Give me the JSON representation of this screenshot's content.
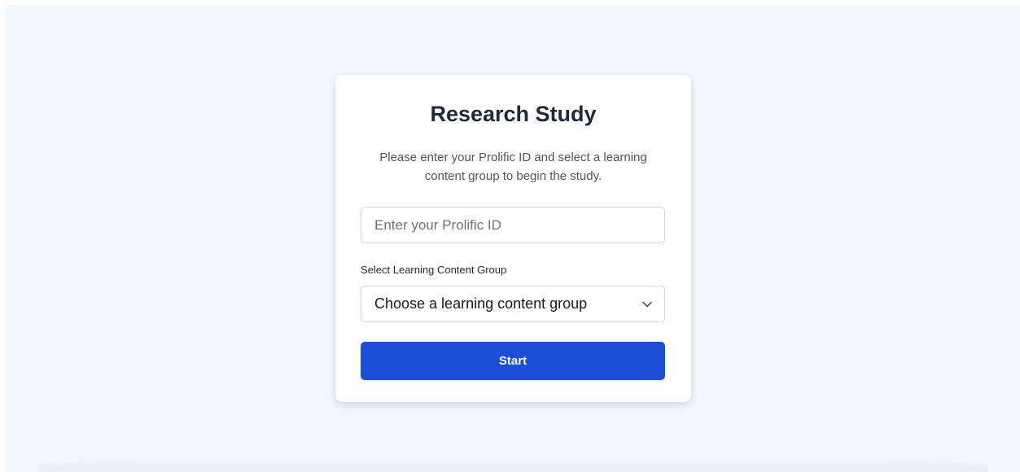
{
  "card": {
    "title": "Research Study",
    "description": "Please enter your Prolific ID and select a learning content group to begin the study.",
    "prolific_input": {
      "value": "",
      "placeholder": "Enter your Prolific ID"
    },
    "group_select": {
      "label": "Select Learning Content Group",
      "selected": "Choose a learning content group",
      "icon": "chevron-down-icon"
    },
    "start_label": "Start"
  },
  "colors": {
    "background": "#eff6ff",
    "card": "#ffffff",
    "title": "#1e293b",
    "primary_button": "#1d4ed8"
  }
}
